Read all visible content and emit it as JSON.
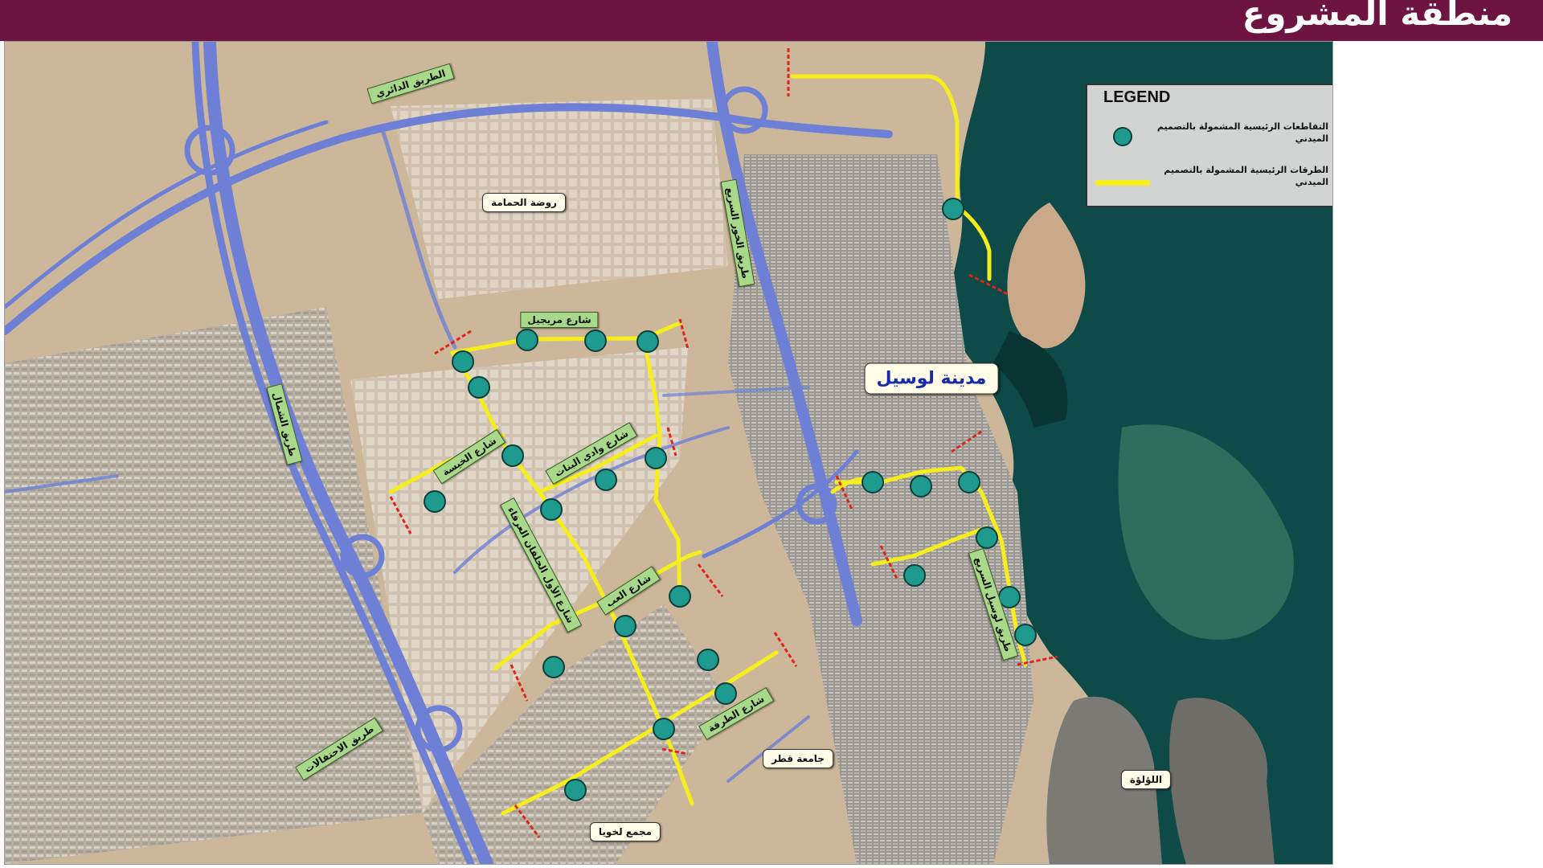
{
  "header": {
    "title": "منطقة المشروع"
  },
  "colors": {
    "header_bg": "#6e1440",
    "project_road": "#f6ee1c",
    "intersection": "#1f9a8f",
    "highway": "#6d80d6",
    "desert": "#cdb79a",
    "sea": "#0e4a47"
  },
  "legend": {
    "title": "LEGEND",
    "items": [
      {
        "icon": "teal-circle-icon",
        "label": "التقاطعات الرئيسية المشمولة بالتصميم الميدني"
      },
      {
        "icon": "yellow-line-icon",
        "label": "الطرقات الرئيسية المشمولة بالتصميم الميدني"
      }
    ]
  },
  "map": {
    "road_labels": {
      "ring_road": "الطريق الدائري",
      "al_khor_expressway": "طريق الخور السريع",
      "north_road": "طريق الشمال",
      "muraijeb_street": "شارع مريجيل",
      "khaisa_street": "شارع الخيسة",
      "wadi_al_banat_street": "شارع وادي البنات",
      "first_intermediate": "شارع الأول الحلفان العرفاء",
      "al_ab_street": "شارع العب",
      "al_tarfa_street": "شارع الطرفة",
      "celebrations_road": "طريق الاحتفالات",
      "lusail_expressway": "طريق لوسيل السريع"
    },
    "place_labels": {
      "rawdat_al_hamama": "روضة الحمامة",
      "lusail_city": "مدينة لوسيل",
      "qatar_mosque": "جامعة قطر",
      "lekhwiya_complex": "مجمع لخويا",
      "the_pearl": "اللؤلؤة"
    }
  }
}
